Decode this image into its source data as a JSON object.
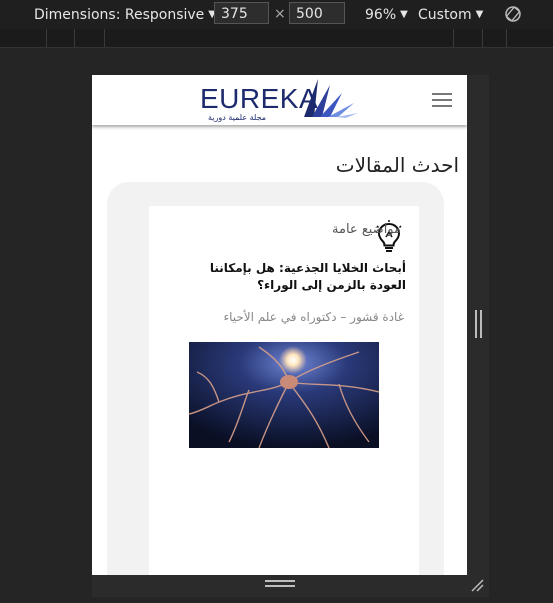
{
  "toolbar": {
    "dimensions_label": "Dimensions: Responsive",
    "width_value": "375",
    "times_symbol": "×",
    "height_value": "500",
    "zoom_label": "96%",
    "throttle_label": "Custom"
  },
  "site": {
    "logo_text": "EUREKA",
    "logo_tagline": "مجلة علمية دورية",
    "section_title": "احدث المقالات",
    "article": {
      "category": "مواضيع عامة",
      "title": "أبحاث الخلايا الجذعية: هل بإمكاننا العودة بالزمن إلى الوراء؟",
      "author": "غادة قشور – دكتوراه في علم الأحياء"
    }
  },
  "colors": {
    "brand": "#1d2a6e",
    "devtools_bg": "#252525"
  }
}
